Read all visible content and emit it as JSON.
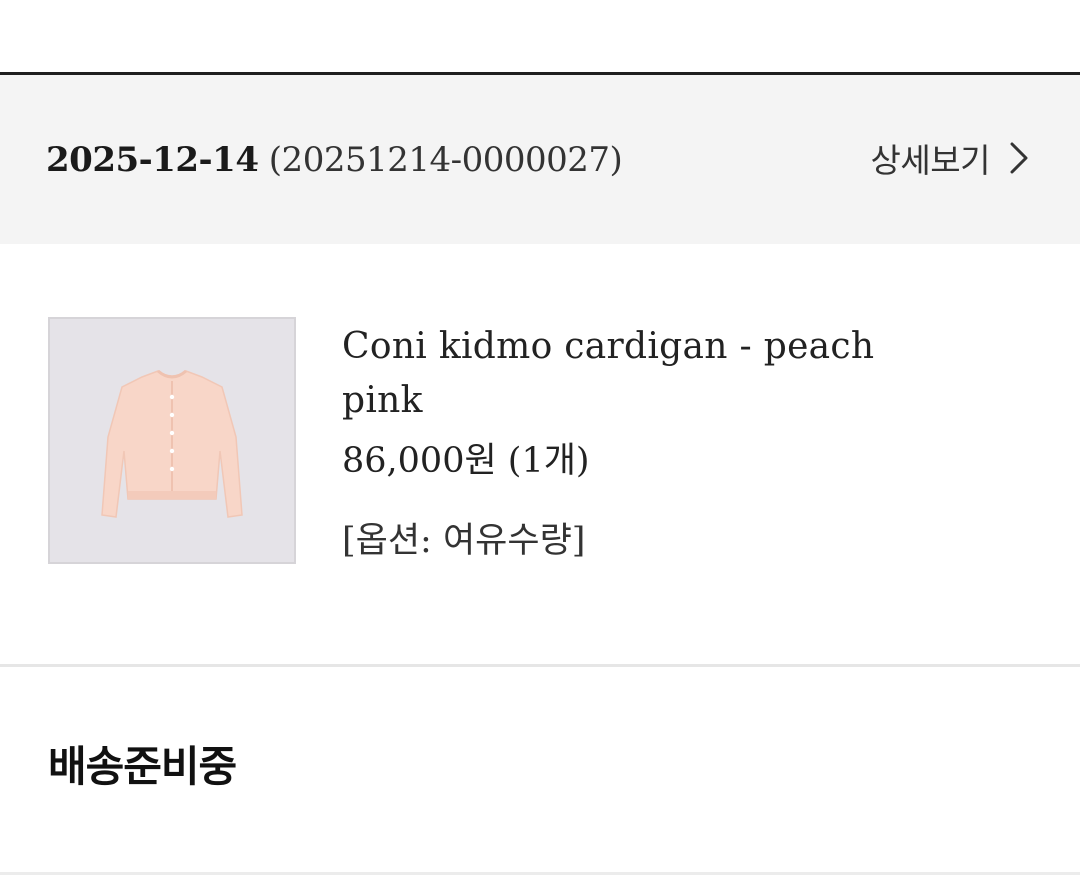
{
  "order": {
    "date": "2025-12-14",
    "number": "(20251214-0000027)",
    "detail_label": "상세보기"
  },
  "product": {
    "image_icon": "cardigan-image",
    "name": "Coni kidmo cardigan - peach pink",
    "price": "86,000원 (1개)",
    "option": "[옵션: 여유수량]"
  },
  "status": {
    "label": "배송준비중"
  },
  "colors": {
    "header_bg": "#f4f4f4",
    "thumb_bg": "#e5e3e8",
    "cardigan": "#f8d6c8",
    "text_dark": "#222222"
  }
}
